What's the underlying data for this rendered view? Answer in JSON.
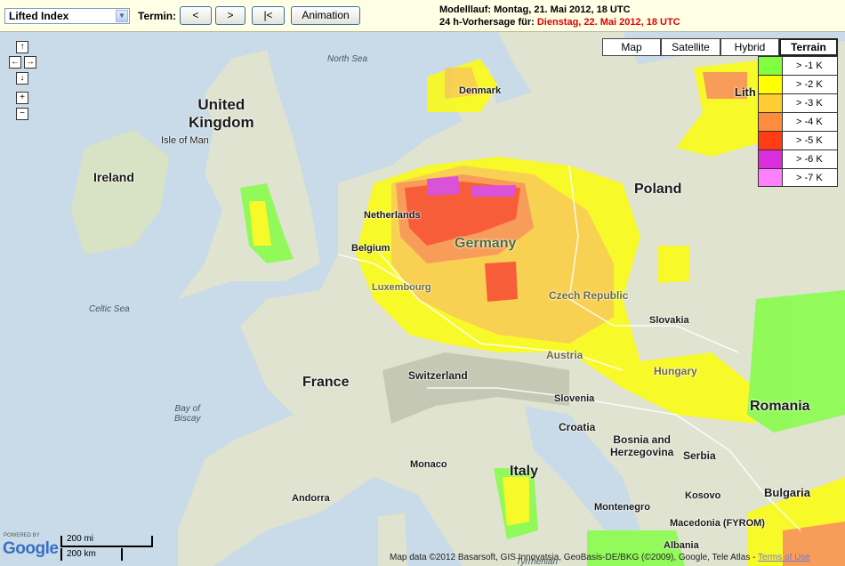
{
  "toolbar": {
    "select_value": "Lifted Index",
    "termin_label": "Termin:",
    "prev_label": "<",
    "next_label": ">",
    "first_label": "|<",
    "animation_label": "Animation",
    "model_run": "Modelllauf: Montag, 21. Mai 2012, 18 UTC",
    "forecast_prefix": "24 h-Vorhersage für: ",
    "forecast_date": "Dienstag, 22. Mai 2012, 18 UTC",
    "forecast_color": "#e00000"
  },
  "map_types": [
    "Map",
    "Satellite",
    "Hybrid",
    "Terrain"
  ],
  "active_map_type": "Terrain",
  "nav_controls": {
    "up": "↑",
    "left": "←",
    "right": "→",
    "down": "↓",
    "zoom_in": "+",
    "zoom_out": "−"
  },
  "legend": [
    {
      "label": "> -1 K",
      "color": "#7fff3f"
    },
    {
      "label": "> -2 K",
      "color": "#ffff00"
    },
    {
      "label": "> -3 K",
      "color": "#ffcc33"
    },
    {
      "label": "> -4 K",
      "color": "#ff8c3c"
    },
    {
      "label": "> -5 K",
      "color": "#ff3c14"
    },
    {
      "label": "> -6 K",
      "color": "#d92ed9"
    },
    {
      "label": "> -7 K",
      "color": "#ff80ff"
    }
  ],
  "labels": {
    "united_kingdom": "United\nKingdom",
    "isle_of_man": "Isle of Man",
    "ireland": "Ireland",
    "celtic_sea": "Celtic Sea",
    "north_sea": "North Sea",
    "denmark": "Denmark",
    "lith": "Lith",
    "poland": "Poland",
    "netherlands": "Netherlands",
    "belgium": "Belgium",
    "germany": "Germany",
    "luxembourg": "Luxembourg",
    "czech": "Czech Republic",
    "slovakia": "Slovakia",
    "france": "France",
    "bay_of_biscay": "Bay of\nBiscay",
    "switzerland": "Switzerland",
    "austria": "Austria",
    "hungary": "Hungary",
    "slovenia": "Slovenia",
    "croatia": "Croatia",
    "bosnia": "Bosnia and\nHerzegovina",
    "serbia": "Serbia",
    "romania": "Romania",
    "monaco": "Monaco",
    "italy": "Italy",
    "andorra": "Andorra",
    "montenegro": "Montenegro",
    "kosovo": "Kosovo",
    "macedonia": "Macedonia (FYROM)",
    "albania": "Albania",
    "bulgaria": "Bulgaria",
    "tyrrhenian": "Tyrrhenian"
  },
  "scale": {
    "mi": "200 mi",
    "km": "200 km"
  },
  "powered_by": "POWERED BY",
  "google": "Google",
  "attribution": "Map data ©2012 Basarsoft, GIS Innovatsia, GeoBasis-DE/BKG (©2009), Google, Tele Atlas - ",
  "terms": "Terms of Use"
}
